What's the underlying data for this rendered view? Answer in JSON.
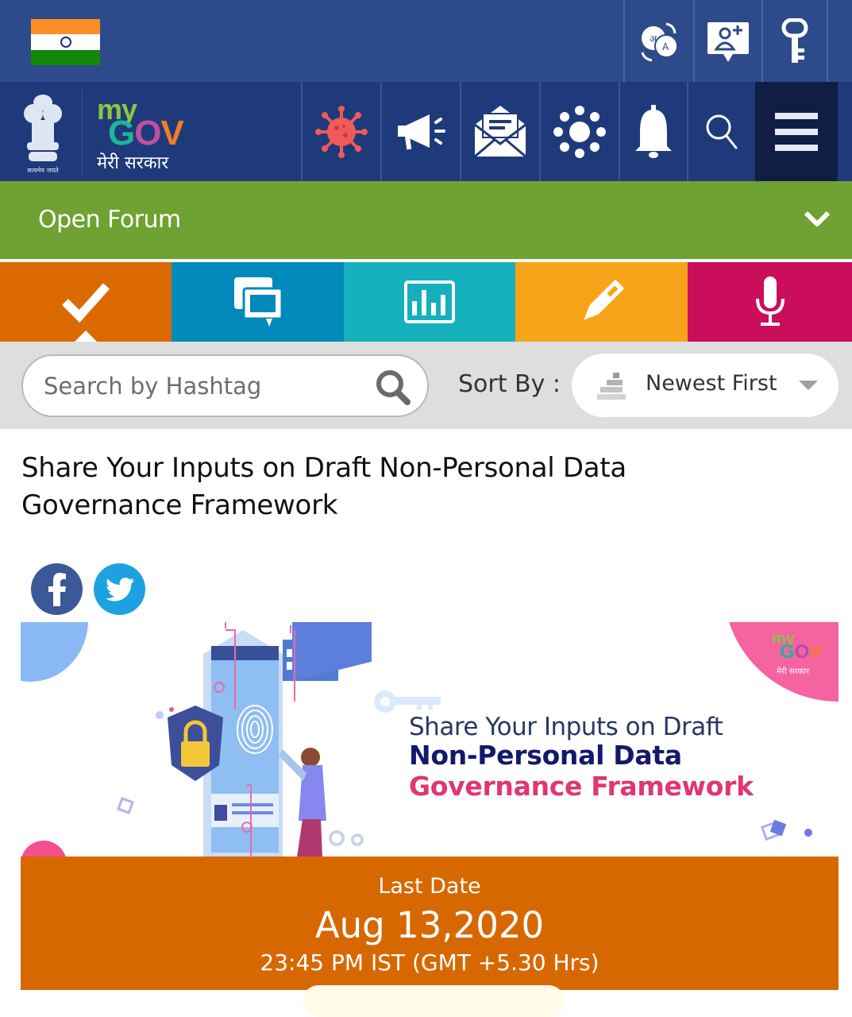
{
  "topbar": {
    "flag": "india-flag",
    "icons": [
      {
        "name": "language-icon",
        "label": "Language"
      },
      {
        "name": "register-icon",
        "label": "Register"
      },
      {
        "name": "login-key-icon",
        "label": "Login"
      }
    ]
  },
  "navbar": {
    "logo": {
      "my": "my",
      "gov_g": "G",
      "gov_o": "O",
      "gov_v": "V",
      "hindi": "मेरी सरकार",
      "emblem_motto": "सत्यमेव जयते"
    },
    "icons": [
      {
        "name": "covid-icon"
      },
      {
        "name": "megaphone-icon"
      },
      {
        "name": "mail-icon"
      },
      {
        "name": "groups-icon"
      },
      {
        "name": "bell-icon"
      },
      {
        "name": "search-icon"
      },
      {
        "name": "hamburger-menu-icon"
      }
    ],
    "colors": {
      "covid": "#f25a5a",
      "active_menu_bg": "#111e44"
    }
  },
  "forum": {
    "label": "Open Forum",
    "color": "#6fa232"
  },
  "category_tabs": [
    {
      "name": "do",
      "icon": "checkmark-icon",
      "color": "#da6a00",
      "active": true
    },
    {
      "name": "discuss",
      "icon": "discussion-icon",
      "color": "#0289bb",
      "active": false
    },
    {
      "name": "poll",
      "icon": "poll-chart-icon",
      "color": "#15b0bb",
      "active": false
    },
    {
      "name": "blog",
      "icon": "pencil-icon",
      "color": "#f8a41a",
      "active": false
    },
    {
      "name": "talk",
      "icon": "microphone-icon",
      "color": "#cb0e5c",
      "active": false
    }
  ],
  "filter": {
    "search_placeholder": "Search by Hashtag",
    "search_value": "",
    "sort_label": "Sort By :",
    "sort_value": "Newest First"
  },
  "post": {
    "title": "Share Your Inputs on Draft Non-Personal Data Governance Framework",
    "share": [
      {
        "name": "facebook",
        "glyph": "f"
      },
      {
        "name": "twitter",
        "glyph": "twitter-bird"
      }
    ],
    "banner": {
      "line1": "Share Your Inputs on Draft",
      "line2": "Non-Personal Data",
      "line3": "Governance Framework",
      "mini_logo_my": "my",
      "mini_logo_g": "G",
      "mini_logo_o": "O",
      "mini_logo_v": "V",
      "mini_logo_hindi": "मेरी सरकार"
    },
    "deadline": {
      "label": "Last Date",
      "date": "Aug 13,2020",
      "time": "23:45 PM IST (GMT +5.30 Hrs)",
      "color": "#d76800"
    }
  }
}
